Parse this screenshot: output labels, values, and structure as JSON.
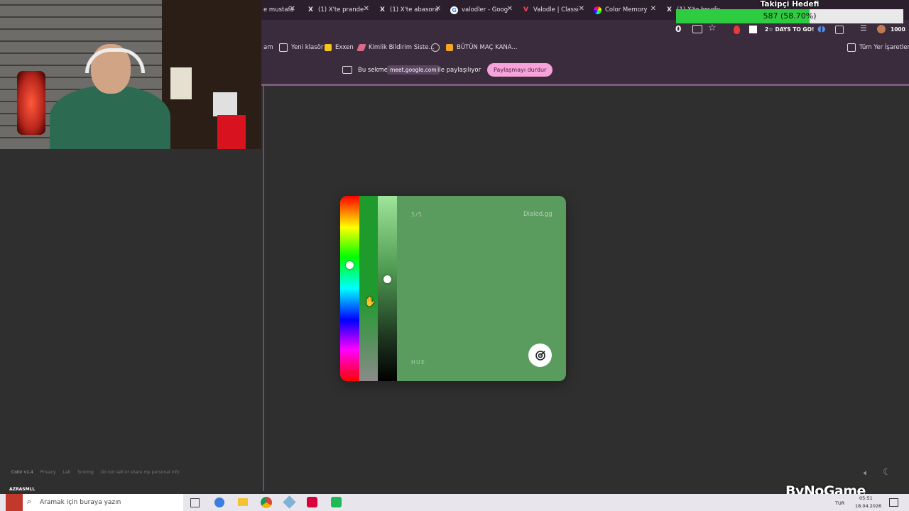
{
  "browser": {
    "tabs": [
      {
        "title": "e mustafa",
        "icon": "x-logo-icon"
      },
      {
        "title": "(1) X'te prande",
        "icon": "x-logo-icon"
      },
      {
        "title": "(1) X'te abasora",
        "icon": "x-logo-icon"
      },
      {
        "title": "valodler - Goog",
        "icon": "google-icon"
      },
      {
        "title": "Valodle | Classi",
        "icon": "valodle-icon"
      },
      {
        "title": "Color Memory",
        "icon": "color-wheel-icon"
      },
      {
        "title": "(1) X'te hrsefe",
        "icon": "x-logo-icon"
      }
    ],
    "toolbar": {
      "counter_left": "0",
      "overlay_text": "2☆ DAYS TO GO!",
      "right_counter": "1000"
    },
    "bookmarks": [
      {
        "label": "am"
      },
      {
        "label": "Yeni klasör"
      },
      {
        "label": "Exxen"
      },
      {
        "label": "Kimlik Bildirim Siste..."
      },
      {
        "label": ""
      },
      {
        "label": "BÜTÜN MAÇ KANA..."
      }
    ],
    "bookmarks_all": "Tüm Yer İşaretleri",
    "share": {
      "prefix": "Bu sekme",
      "domain": "meet.google.com",
      "suffix": "ile paylaşılıyor",
      "stop_label": "Paylaşmayı durdur"
    }
  },
  "overlay": {
    "follower_goal_title": "Takipçi Hedefi",
    "follower_goal_value": "587 (58.70%)",
    "follower_goal_fraction": 0.587,
    "brand": "ByNoGame",
    "streamer_tag": "AZRASMLL"
  },
  "game": {
    "progress": "5/5",
    "brand": "Dialed.gg",
    "mode_label": "HUE",
    "colors": {
      "card": "#5a9b5e",
      "base_hue": "#1f9a2c",
      "light": "#9fe59a"
    },
    "hue_level": 0.37,
    "lightness_level": 0.45
  },
  "footer": {
    "version": "Color v1.4",
    "links": [
      "Privacy",
      "Lab",
      "Scoring",
      "Do not sell or share my personal info"
    ]
  },
  "taskbar": {
    "search_placeholder": "Aramak için buraya yazın",
    "lang": "TUR",
    "time": "05:51",
    "date": "18.04.2026"
  }
}
